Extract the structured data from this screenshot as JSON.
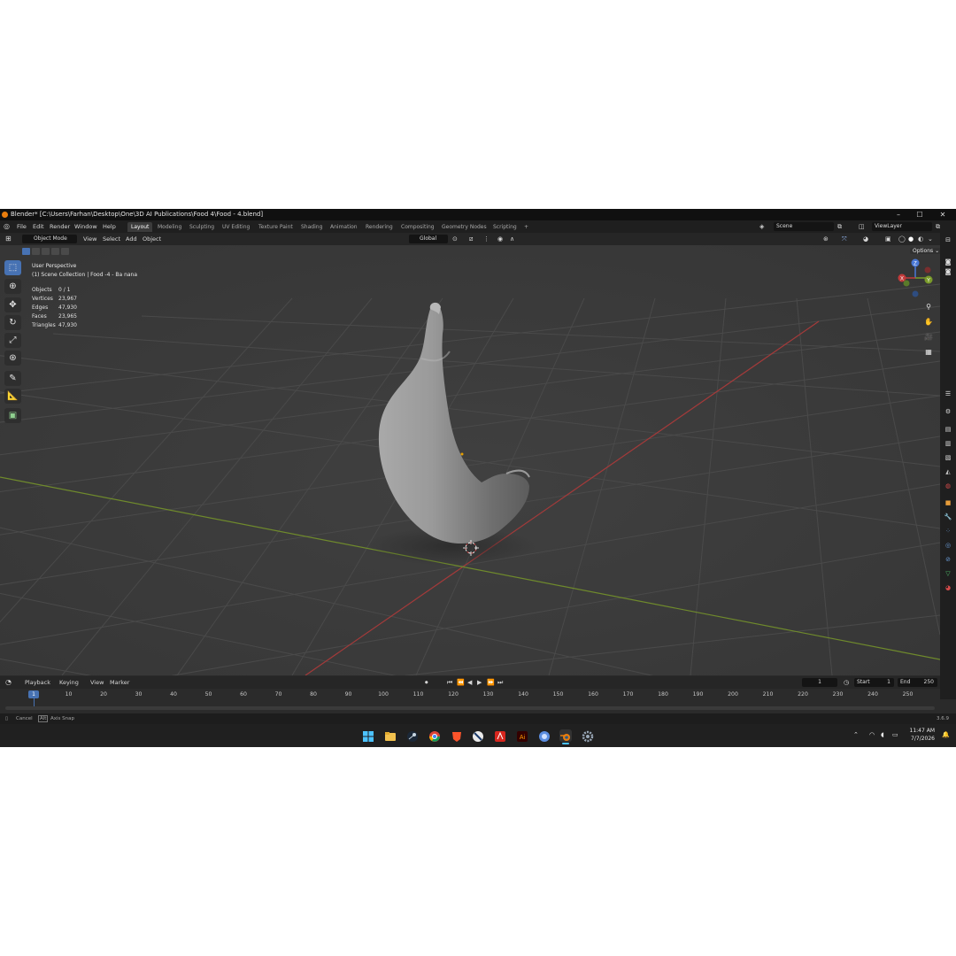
{
  "window": {
    "title": "Blender* [C:\\Users\\Farhan\\Desktop\\One\\3D AI Publications\\Food 4\\Food - 4.blend]",
    "controls": [
      "–",
      "☐",
      "✕"
    ]
  },
  "menubar": {
    "menus": [
      "File",
      "Edit",
      "Render",
      "Window",
      "Help"
    ],
    "workspaces": [
      "Layout",
      "Modeling",
      "Sculpting",
      "UV Editing",
      "Texture Paint",
      "Shading",
      "Animation",
      "Rendering",
      "Compositing",
      "Geometry Nodes",
      "Scripting"
    ],
    "active_workspace": "Layout",
    "add_tab": "+",
    "scene": "Scene",
    "view_layer": "ViewLayer"
  },
  "viewport_header": {
    "mode": "Object Mode",
    "menus": [
      "View",
      "Select",
      "Add",
      "Object"
    ],
    "transform_orientation": "Global",
    "options": "Options"
  },
  "viewport_overlay": {
    "perspective": "User Perspective",
    "collection": "(1) Scene Collection | Food -4 - Ba nana",
    "stats": [
      {
        "label": "Objects",
        "value": "0 / 1"
      },
      {
        "label": "Vertices",
        "value": "23,967"
      },
      {
        "label": "Edges",
        "value": "47,930"
      },
      {
        "label": "Faces",
        "value": "23,965"
      },
      {
        "label": "Triangles",
        "value": "47,930"
      }
    ],
    "gizmo_axes": [
      "X",
      "Y",
      "Z"
    ]
  },
  "toolbar": {
    "tools": [
      "select-box",
      "cursor",
      "move",
      "rotate",
      "scale",
      "transform",
      "annotate",
      "measure",
      "add-cube"
    ],
    "active_tool": "select-box"
  },
  "timeline": {
    "menus": [
      "Playback",
      "Keying",
      "View",
      "Marker"
    ],
    "current_frame": "1",
    "start_label": "Start",
    "start": "1",
    "end_label": "End",
    "end": "250",
    "frame_marks": [
      "10",
      "20",
      "30",
      "40",
      "50",
      "60",
      "70",
      "80",
      "90",
      "100",
      "110",
      "120",
      "130",
      "140",
      "150",
      "160",
      "170",
      "180",
      "190",
      "200",
      "210",
      "220",
      "230",
      "240",
      "250"
    ],
    "cursor_frame": "1"
  },
  "statusbar": {
    "cancel": "Cancel",
    "axis_snap": "Axis Snap",
    "version": "3.6.9"
  },
  "taskbar": {
    "time": "11:47 AM",
    "date": "7/7/2026"
  },
  "colors": {
    "accent": "#4772b3",
    "x_axis": "#c23a3a",
    "y_axis": "#7a9b2a",
    "z_axis": "#4a78d6"
  }
}
